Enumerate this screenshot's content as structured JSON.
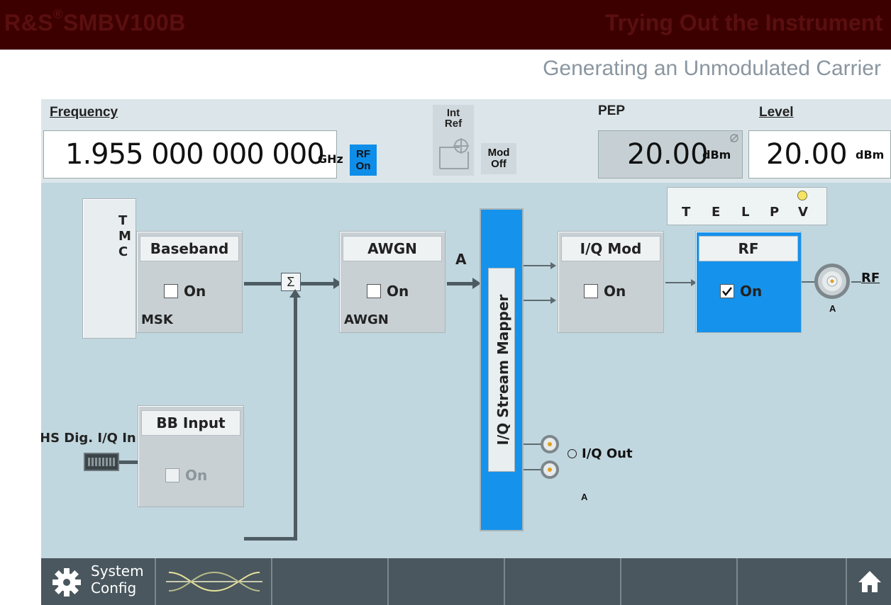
{
  "doc": {
    "brand": "R&S",
    "brand_sup": "®",
    "brand_model": "SMBV100B",
    "chapter": "Trying Out the Instrument",
    "section": "Generating an Unmodulated Carrier"
  },
  "status_bar": {
    "frequency_label": "Frequency",
    "frequency_value": "1.955 000 000 000",
    "frequency_unit": "GHz",
    "rf_badge_line1": "RF",
    "rf_badge_line2": "On",
    "int_ref_line1": "Int",
    "int_ref_line2": "Ref",
    "mod_line1": "Mod",
    "mod_line2": "Off",
    "pep_label": "PEP",
    "pep_value": "20.00",
    "pep_unit": "dBm",
    "level_label": "Level",
    "level_value": "20.00",
    "level_unit": "dBm"
  },
  "diagram": {
    "tmc": [
      "T",
      "M",
      "C"
    ],
    "baseband": {
      "title": "Baseband",
      "on_label": "On",
      "sub": "MSK",
      "checked": false
    },
    "sum_symbol": "Σ",
    "awgn": {
      "title": "AWGN",
      "on_label": "On",
      "sub": "AWGN",
      "checked": false
    },
    "path_a": "A",
    "stream_mapper": "I/Q Stream Mapper",
    "iq_mod": {
      "title": "I/Q Mod",
      "on_label": "On",
      "checked": false
    },
    "rf": {
      "title": "RF",
      "on_label": "On",
      "checked": true
    },
    "telpv": [
      "T",
      "E",
      "L",
      "P",
      "V"
    ],
    "rf_connector_label": "RF",
    "rf_connector_sub": "A",
    "hs_dig_label": "HS Dig. I/Q In",
    "bb_input": {
      "title": "BB Input",
      "on_label": "On",
      "checked": false
    },
    "iq_out_label": "I/Q Out",
    "iq_out_sub": "A"
  },
  "taskbar": {
    "system_line1": "System",
    "system_line2": "Config"
  },
  "colors": {
    "accent_blue": "#0e8ee9",
    "screen_bg": "#c1d7df",
    "header_bg": "#3d0000"
  }
}
